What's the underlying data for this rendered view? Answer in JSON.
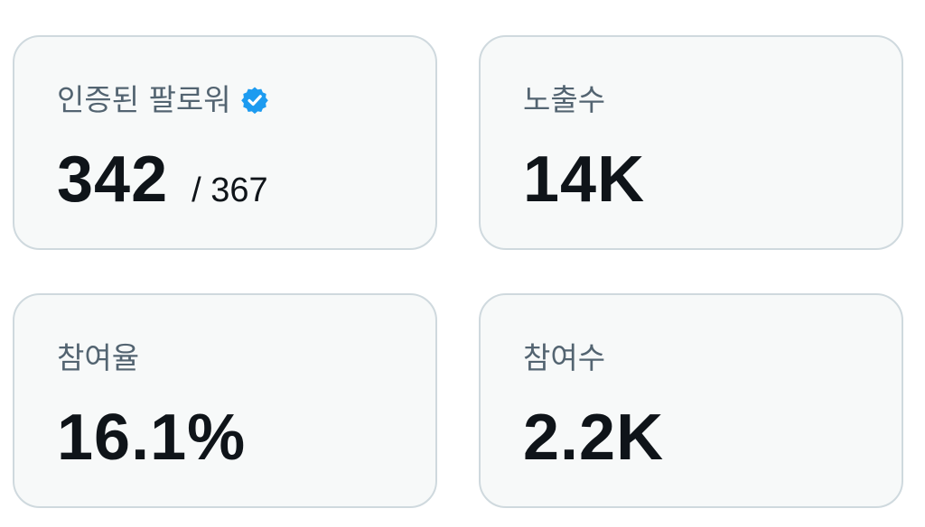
{
  "stats": [
    {
      "label": "인증된 팔로워",
      "value": "342",
      "sub": "/ 367",
      "icon": "verified-badge-icon"
    },
    {
      "label": "노출수",
      "value": "14K"
    },
    {
      "label": "참여율",
      "value": "16.1%"
    },
    {
      "label": "참여수",
      "value": "2.2K"
    }
  ],
  "colors": {
    "card_bg": "#f7f9f9",
    "card_border": "#cfd9de",
    "label": "#536471",
    "value": "#0f1419",
    "verified": "#1d9bf0"
  }
}
